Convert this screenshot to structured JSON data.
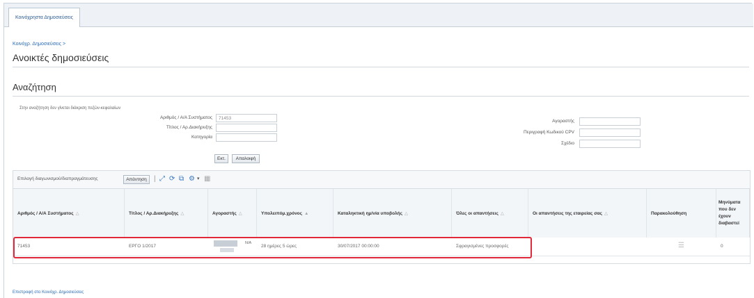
{
  "tab": {
    "label": "Κοινόχρηστα Δημοσιεύσεις"
  },
  "breadcrumb": "Κοινόχρ. Δημοσιεύσεις >",
  "page_title": "Ανοικτές δημοσιεύσεις",
  "search": {
    "section_title": "Αναζήτηση",
    "note": "Στην αναζήτηση δεν γίνεται διάκριση πεζών-κεφαλαίων",
    "fields": {
      "number_label": "Αριθμός / Α/Α Συστήματος",
      "number_value": "71453",
      "title_label": "Τίτλος / Αρ.Διακήρυξης",
      "title_value": "",
      "category_label": "Κατηγορία",
      "category_value": "",
      "buyer_label": "Αγοραστής",
      "buyer_value": "",
      "cpv_label": "Περιγραφή Κωδικού CPV",
      "cpv_value": "",
      "other_label": "Σχέδιο",
      "other_value": ""
    },
    "go_button": "Εκτ.",
    "clear_button": "Απαλοιφή"
  },
  "table": {
    "toolbar_label": "Επιλογή διαγωνισμού/διαπραγμάτευσης",
    "respond_button": "Απάντηση",
    "columns": [
      "Αριθμός / Α/Α Συστήματος",
      "Τίτλος / Αρ.Διακήρυξης",
      "Αγοραστής",
      "Υπολειπόμ.χρόνος",
      "Καταληκτική ημ/νία υποβολής",
      "Όλες οι απαντήσεις",
      "Οι απαντήσεις της εταιρείας σας",
      "Παρακολούθηση",
      "Μηνύματα που δεν έχουν διαβαστεί"
    ],
    "rows": [
      {
        "number": "71453",
        "title": "ΕΡΓΟ 1/2017",
        "buyer": "Ν/Α",
        "remaining": "28 ημέρες 5 ώρες",
        "deadline": "30/07/2017 00:00:00",
        "all_responses": "Σφραγισμένες προσφορές",
        "company_responses": "",
        "unread": "0"
      }
    ]
  },
  "footer_link": "Επιστροφή στο Κοινόχρ. Δημοσιεύσεις",
  "colors": {
    "link": "#2a6bb3",
    "highlight": "#e0283a"
  }
}
